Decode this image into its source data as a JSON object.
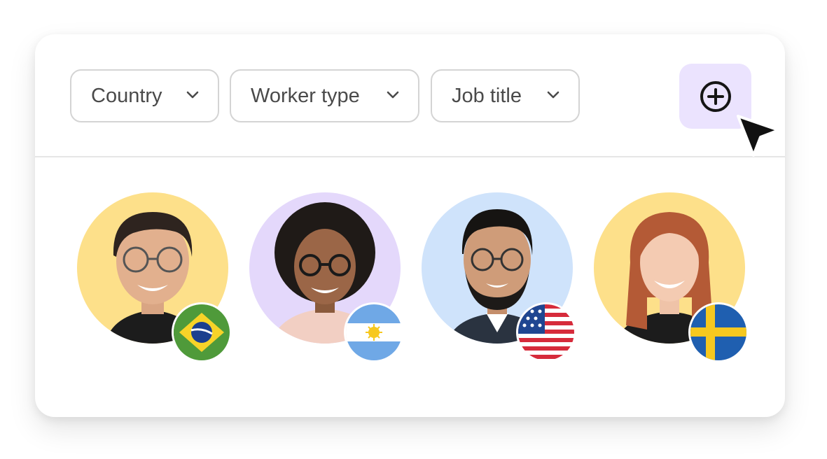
{
  "filters": {
    "country_label": "Country",
    "worker_type_label": "Worker type",
    "job_title_label": "Job title"
  },
  "add_button": {
    "icon": "plus-circle-icon"
  },
  "colors": {
    "accent_light": "#ebe3fe",
    "avatar_yellow": "#fde08a",
    "avatar_purple": "#e4d8fb",
    "avatar_blue": "#cfe3fb"
  },
  "people": [
    {
      "flag": "brazil-flag-icon",
      "bg": "#fde08a"
    },
    {
      "flag": "argentina-flag-icon",
      "bg": "#e4d8fb"
    },
    {
      "flag": "usa-flag-icon",
      "bg": "#cfe3fb"
    },
    {
      "flag": "sweden-flag-icon",
      "bg": "#fde08a"
    }
  ]
}
